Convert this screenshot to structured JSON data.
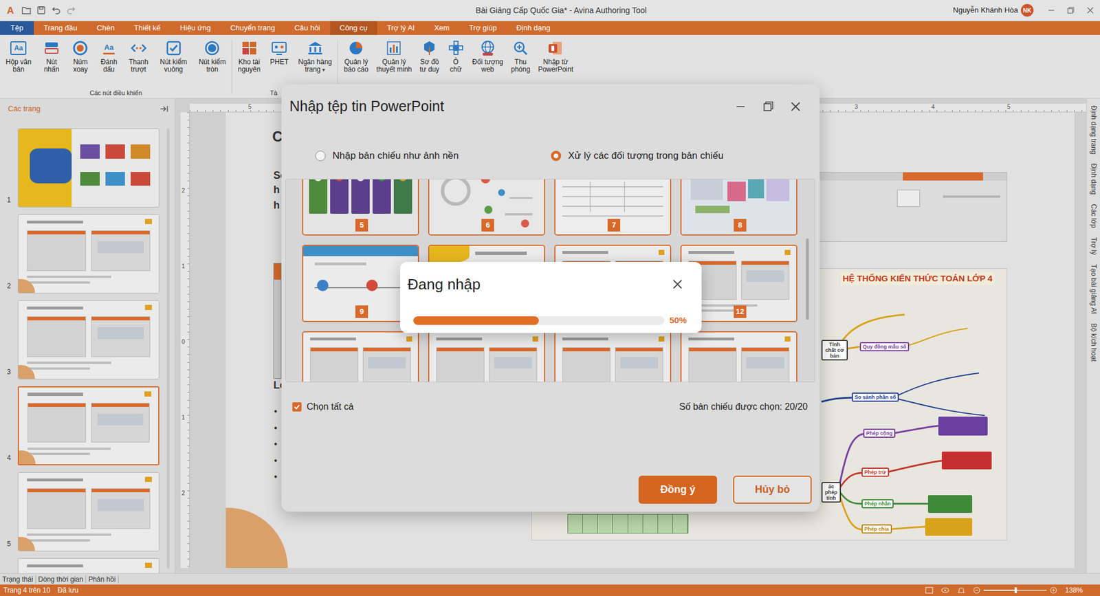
{
  "window": {
    "logo": "A",
    "title": "Bài Giảng Cấp Quốc Gia* - Avina Authoring Tool",
    "user": "Nguyễn Khánh Hòa",
    "avatar": "NK"
  },
  "menu": [
    {
      "label": "Tệp",
      "kind": "file",
      "selected": false
    },
    {
      "label": "Trang đầu",
      "kind": "tab",
      "selected": false
    },
    {
      "label": "Chèn",
      "kind": "tab",
      "selected": false
    },
    {
      "label": "Thiết kế",
      "kind": "tab",
      "selected": false
    },
    {
      "label": "Hiệu ứng",
      "kind": "tab",
      "selected": false
    },
    {
      "label": "Chuyển trang",
      "kind": "tab",
      "selected": false
    },
    {
      "label": "Câu hỏi",
      "kind": "tab",
      "selected": false
    },
    {
      "label": "Công cụ",
      "kind": "tab",
      "selected": true
    },
    {
      "label": "Trợ lý AI",
      "kind": "tab",
      "selected": false
    },
    {
      "label": "Xem",
      "kind": "tab",
      "selected": false
    },
    {
      "label": "Trợ giúp",
      "kind": "tab",
      "selected": false
    },
    {
      "label": "Định dạng",
      "kind": "tab",
      "selected": false
    }
  ],
  "ribbon": {
    "groups": [
      {
        "label": "Các nút điều khiển",
        "items": [
          {
            "lines": [
              "Hộp văn",
              "bản"
            ],
            "icon_text": "Aa"
          },
          {
            "lines": [
              "Nút",
              "nhấn"
            ]
          },
          {
            "lines": [
              "Núm",
              "xoay"
            ]
          },
          {
            "lines": [
              "Đánh",
              "dấu"
            ],
            "icon_text": "Aa"
          },
          {
            "lines": [
              "Thanh",
              "trượt"
            ]
          },
          {
            "lines": [
              "Nút kiểm",
              "vuông"
            ]
          },
          {
            "lines": [
              "Nút kiểm",
              "tròn"
            ]
          }
        ]
      },
      {
        "label": "Tà",
        "items": [
          {
            "lines": [
              "Kho tài",
              "nguyên"
            ]
          },
          {
            "lines": [
              "PHET"
            ]
          },
          {
            "lines": [
              "Ngân hàng",
              "trang"
            ],
            "dropdown": "▾"
          }
        ]
      },
      {
        "items": [
          {
            "lines": [
              "Quản lý",
              "báo cáo"
            ]
          },
          {
            "lines": [
              "Quản lý",
              "thuyết minh"
            ]
          },
          {
            "lines": [
              "Sơ đồ",
              "tư duy"
            ]
          },
          {
            "lines": [
              "Ô",
              "chữ"
            ]
          },
          {
            "lines": [
              "Đối tượng",
              "web"
            ]
          },
          {
            "lines": [
              "Thu",
              "phóng"
            ]
          },
          {
            "lines": [
              "Nhập từ",
              "PowerPoint"
            ]
          }
        ]
      }
    ]
  },
  "slides_panel": {
    "title": "Các trang",
    "items": [
      {
        "number": "1",
        "selected": false
      },
      {
        "number": "2",
        "selected": false
      },
      {
        "number": "3",
        "selected": false
      },
      {
        "number": "4",
        "selected": true
      },
      {
        "number": "5",
        "selected": false
      },
      {
        "selected": false
      }
    ]
  },
  "canvas": {
    "rulers": {
      "horizontal": [
        "5",
        "3",
        "4",
        "5"
      ],
      "vertical": [
        "2",
        "1",
        "0",
        "1",
        "2"
      ]
    },
    "slide": {
      "heading": "C",
      "lines": [
        "Sơ",
        "h",
        "h"
      ],
      "subheading": "Lo",
      "bullets": [
        "•",
        "•",
        "•",
        "•",
        "•"
      ],
      "mindmap": {
        "title": "HỆ THỐNG KIẾN THỨC TOÁN LỚP 4",
        "nodes": [
          {
            "label": "Tính chất cơ bản",
            "color": "#3a3a3a"
          },
          {
            "label": "Quy đồng mẫu số",
            "color": "#7a3f9e"
          },
          {
            "label": "So sánh phân số",
            "color": "#1f3f8f"
          },
          {
            "label": "Phép cộng",
            "color": "#7a3f9e"
          },
          {
            "label": "Phép trừ",
            "color": "#c0392b"
          },
          {
            "label": "Phép nhân",
            "color": "#3f8a3a"
          },
          {
            "label": "Phép chia",
            "color": "#b8860b"
          },
          {
            "label": "ác phép tính",
            "color": "#3a3a3a"
          }
        ],
        "formula_boxes": [
          {
            "color": "#6b3fa0"
          },
          {
            "color": "#c62f2f"
          },
          {
            "color": "#3f8a3a"
          },
          {
            "color": "#d9a21b"
          }
        ]
      }
    }
  },
  "side_tabs": [
    "Định dạng trang",
    "Định dạng",
    "Các lớp",
    "Trợ lý",
    "Tạo bài giảng AI",
    "Bộ kích hoạt"
  ],
  "bottom_tabs": [
    "Trạng thái",
    "Dòng thời gian",
    "Phản hồi"
  ],
  "status_bar": {
    "page": "Trang 4 trên 10",
    "saved": "Đã lưu",
    "zoom": {
      "level": 0.51,
      "reading": "138%"
    }
  },
  "dialog": {
    "title": "Nhập tệp tin PowerPoint",
    "options": [
      {
        "label": "Nhập bản chiếu như ảnh nền",
        "selected": false
      },
      {
        "label": "Xử lý các đối tượng trong bản chiếu",
        "selected": true
      }
    ],
    "thumbnails": [
      {
        "number": "5",
        "selected": true
      },
      {
        "number": "6",
        "selected": true
      },
      {
        "number": "7",
        "selected": true
      },
      {
        "number": "8",
        "selected": true
      },
      {
        "number": "9",
        "selected": true
      },
      {
        "selected": true
      },
      {
        "selected": true
      },
      {
        "number": "12",
        "selected": true
      },
      {
        "selected": true
      },
      {
        "selected": true
      },
      {
        "selected": true
      },
      {
        "selected": true
      }
    ],
    "scroll": {
      "start": 0.29,
      "size": 0.4
    },
    "select_all": {
      "label": "Chọn tất cả",
      "checked": true
    },
    "count": "Số bản chiếu được chọn: 20/20",
    "buttons": [
      {
        "label": "Đồng ý",
        "kind": "primary"
      },
      {
        "label": "Hủy bỏ",
        "kind": "secondary"
      }
    ]
  },
  "progress": {
    "title": "Đang nhập",
    "level": 0.5,
    "reading": "50%"
  }
}
